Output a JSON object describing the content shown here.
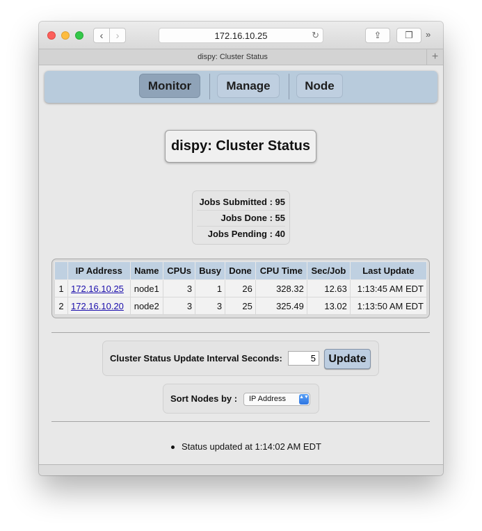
{
  "browser": {
    "url": "172.16.10.25",
    "tab_title": "dispy: Cluster Status",
    "back_glyph": "‹",
    "forward_glyph": "›",
    "reload_glyph": "↻",
    "share_glyph": "⇪",
    "tabs_glyph": "❐",
    "more_glyph": "»",
    "new_tab_glyph": "+"
  },
  "nav": {
    "items": [
      {
        "label": "Monitor",
        "active": true
      },
      {
        "label": "Manage",
        "active": false
      },
      {
        "label": "Node",
        "active": false
      }
    ]
  },
  "page": {
    "title": "dispy: Cluster Status"
  },
  "summary": {
    "submitted_label": "Jobs Submitted :",
    "submitted_value": "95",
    "done_label": "Jobs Done :",
    "done_value": "55",
    "pending_label": "Jobs Pending :",
    "pending_value": "40"
  },
  "nodes_table": {
    "headers": [
      "",
      "IP Address",
      "Name",
      "CPUs",
      "Busy",
      "Done",
      "CPU Time",
      "Sec/Job",
      "Last Update"
    ],
    "rows": [
      [
        "1",
        "172.16.10.25",
        "node1",
        "3",
        "1",
        "26",
        "328.32",
        "12.63",
        "1:13:45 AM EDT"
      ],
      [
        "2",
        "172.16.10.20",
        "node2",
        "3",
        "3",
        "25",
        "325.49",
        "13.02",
        "1:13:50 AM EDT"
      ]
    ]
  },
  "interval": {
    "label": "Cluster Status Update Interval Seconds:",
    "value": "5",
    "button": "Update"
  },
  "sort": {
    "label": "Sort Nodes by :",
    "selected": "IP Address",
    "arrow_glyph": "▲▼"
  },
  "status": {
    "message": "Status updated at 1:14:02 AM EDT"
  },
  "colors": {
    "nav_bg": "#b8cbdc",
    "nav_active": "#8fa3b8",
    "table_header": "#bfd0e1",
    "link": "#1a0dab"
  }
}
